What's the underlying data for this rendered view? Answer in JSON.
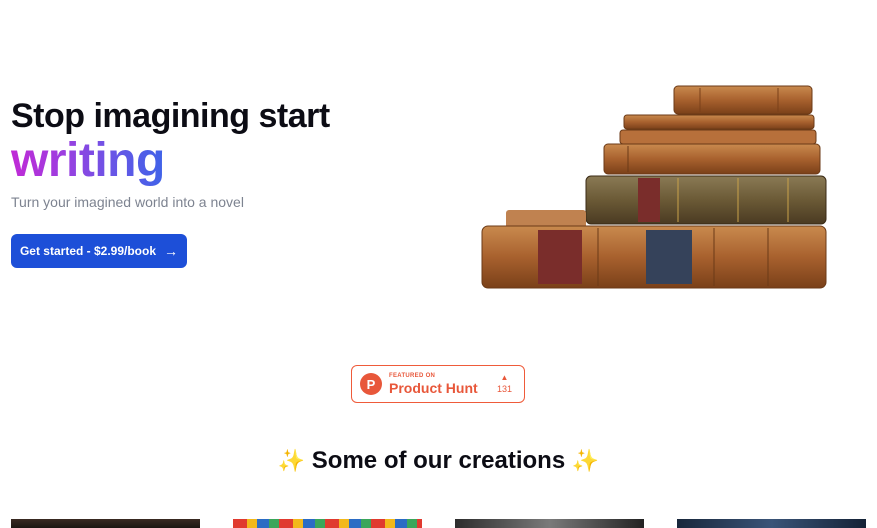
{
  "hero": {
    "title": "Stop imagining start",
    "accent": "writing",
    "subtitle": "Turn your imagined world into a novel",
    "cta_label": "Get started - $2.99/book",
    "cta_icon": "arrow-right-icon"
  },
  "product_hunt": {
    "small_label": "FEATURED ON",
    "name": "Product Hunt",
    "logo_letter": "P",
    "votes_icon": "▲",
    "votes": "131",
    "color": "#e8573a"
  },
  "creations": {
    "title": "Some of our creations",
    "sparkle_left": "✨",
    "sparkle_right": "✨"
  },
  "colors": {
    "primary_button": "#1d4fd8",
    "accent_gradient_start": "#c02ad6",
    "accent_gradient_end": "#3f63e8"
  }
}
